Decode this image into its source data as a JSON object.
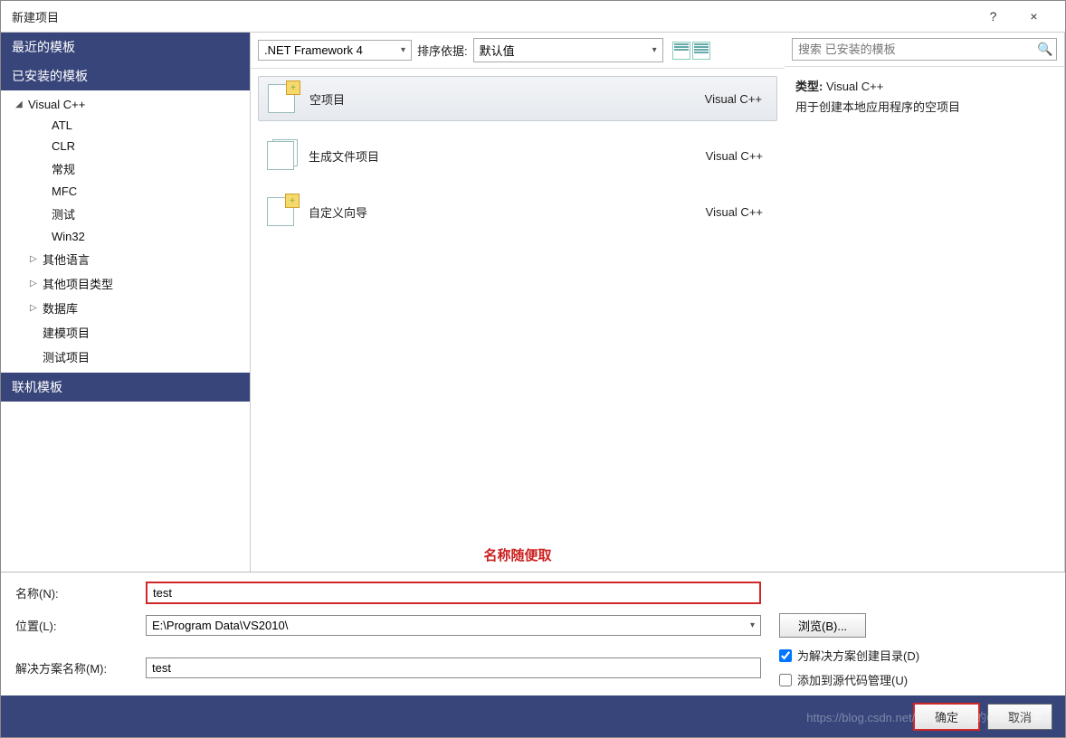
{
  "titlebar": {
    "title": "新建项目",
    "help": "?",
    "close": "×"
  },
  "sidebar": {
    "recent": "最近的模板",
    "installed": "已安装的模板",
    "online": "联机模板",
    "tree": {
      "root": "Visual C++",
      "children": [
        "ATL",
        "CLR",
        "常规",
        "MFC",
        "测试",
        "Win32"
      ],
      "others": [
        "其他语言",
        "其他项目类型",
        "数据库",
        "建模项目",
        "测试项目"
      ]
    }
  },
  "toolbar": {
    "framework": ".NET Framework 4",
    "sortlabel": "排序依据:",
    "sortvalue": "默认值"
  },
  "search": {
    "placeholder": "搜索 已安装的模板"
  },
  "templates": [
    {
      "name": "空项目",
      "lang": "Visual C++",
      "selected": true
    },
    {
      "name": "生成文件项目",
      "lang": "Visual C++",
      "selected": false
    },
    {
      "name": "自定义向导",
      "lang": "Visual C++",
      "selected": false
    }
  ],
  "annotation": "名称随便取",
  "description": {
    "typelabel": "类型:",
    "typevalue": "Visual C++",
    "text": "用于创建本地应用程序的空项目"
  },
  "form": {
    "namelabel": "名称(N):",
    "namevalue": "test",
    "loclabel": "位置(L):",
    "locvalue": "E:\\Program Data\\VS2010\\",
    "sollabel": "解决方案名称(M):",
    "solvalue": "test",
    "browse": "浏览(B)...",
    "createdir": "为解决方案创建目录(D)",
    "addscc": "添加到源代码管理(U)"
  },
  "footer": {
    "ok": "确定",
    "cancel": "取消",
    "watermark": "https://blog.csdn.net/tangjin@51的CSDN博客"
  }
}
